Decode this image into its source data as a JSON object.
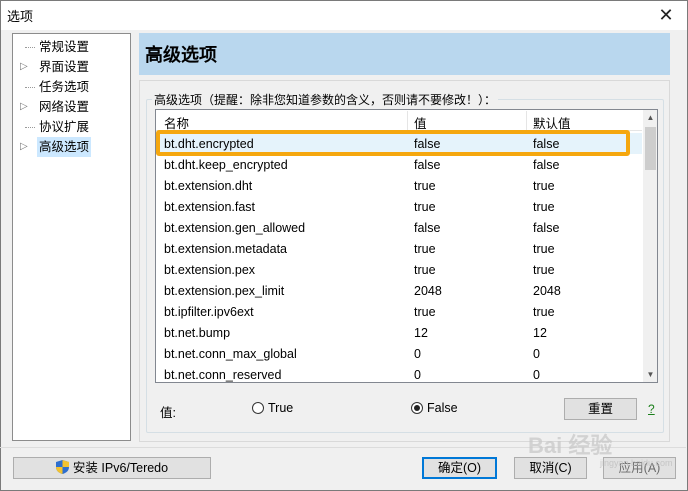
{
  "window": {
    "title": "选项",
    "close_glyph": "✕"
  },
  "sidebar": {
    "items": [
      {
        "label": "常规设置",
        "expandable": false,
        "selected": false
      },
      {
        "label": "界面设置",
        "expandable": true,
        "selected": false
      },
      {
        "label": "任务选项",
        "expandable": false,
        "selected": false
      },
      {
        "label": "网络设置",
        "expandable": true,
        "selected": false
      },
      {
        "label": "协议扩展",
        "expandable": false,
        "selected": false
      },
      {
        "label": "高级选项",
        "expandable": true,
        "selected": true
      }
    ]
  },
  "main": {
    "title": "高级选项",
    "group_label": "高级选项（提醒：除非您知道参数的含义，否则请不要修改！）：",
    "columns": [
      "名称",
      "值",
      "默认值"
    ],
    "rows": [
      {
        "name": "bt.dht.encrypted",
        "value": "false",
        "default": "false"
      },
      {
        "name": "bt.dht.keep_encrypted",
        "value": "false",
        "default": "false"
      },
      {
        "name": "bt.extension.dht",
        "value": "true",
        "default": "true"
      },
      {
        "name": "bt.extension.fast",
        "value": "true",
        "default": "true"
      },
      {
        "name": "bt.extension.gen_allowed",
        "value": "false",
        "default": "false"
      },
      {
        "name": "bt.extension.metadata",
        "value": "true",
        "default": "true"
      },
      {
        "name": "bt.extension.pex",
        "value": "true",
        "default": "true"
      },
      {
        "name": "bt.extension.pex_limit",
        "value": "2048",
        "default": "2048"
      },
      {
        "name": "bt.ipfilter.ipv6ext",
        "value": "true",
        "default": "true"
      },
      {
        "name": "bt.net.bump",
        "value": "12",
        "default": "12"
      },
      {
        "name": "bt.net.conn_max_global",
        "value": "0",
        "default": "0"
      },
      {
        "name": "bt.net.conn_reserved",
        "value": "0",
        "default": "0"
      }
    ],
    "value_label": "值:",
    "radio_true": "True",
    "radio_false": "False",
    "selected_value": "False",
    "reset_label": "重置",
    "help_label": "?"
  },
  "footer": {
    "install_label": "安装 IPv6/Teredo",
    "ok_label": "确定(O)",
    "cancel_label": "取消(C)",
    "apply_label": "应用(A)"
  },
  "watermark": {
    "text": "Bai 经验",
    "sub": "jingyan.baidu.com"
  },
  "colors": {
    "header_bg": "#b9d7ee",
    "highlight": "#f5a70f",
    "selection": "#e5f3fb"
  }
}
